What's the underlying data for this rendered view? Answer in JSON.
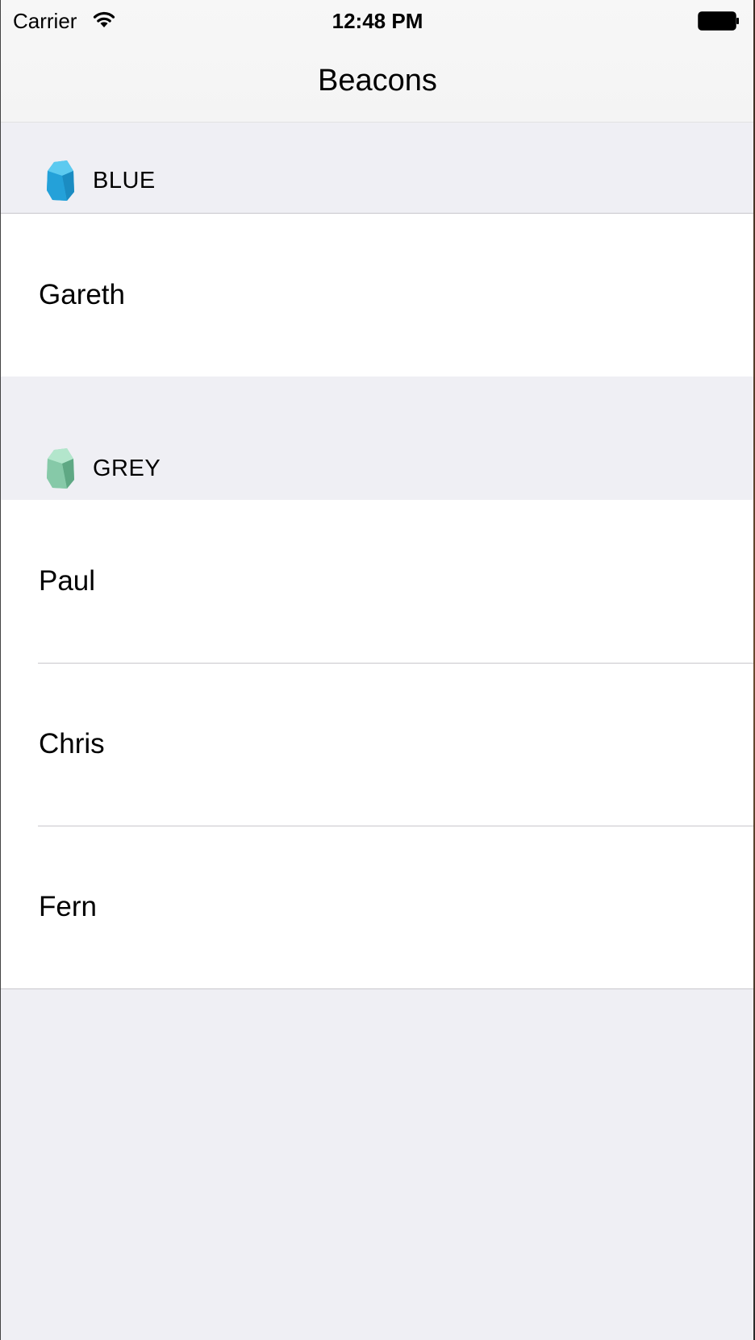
{
  "status_bar": {
    "carrier": "Carrier",
    "time": "12:48 PM",
    "wifi_icon": "wifi-icon",
    "battery_icon": "battery-icon"
  },
  "nav": {
    "title": "Beacons"
  },
  "sections": [
    {
      "label": "BLUE",
      "icon": "beacon-blue-icon",
      "icon_color": "#29aae1",
      "rows": [
        {
          "label": "Gareth"
        }
      ]
    },
    {
      "label": "GREY",
      "icon": "beacon-mint-icon",
      "icon_color": "#8fd3b2",
      "rows": [
        {
          "label": "Paul"
        },
        {
          "label": "Chris"
        },
        {
          "label": "Fern"
        }
      ]
    }
  ],
  "colors": {
    "background": "#efeff4",
    "cell_background": "#ffffff",
    "separator": "#c8c7cc"
  }
}
